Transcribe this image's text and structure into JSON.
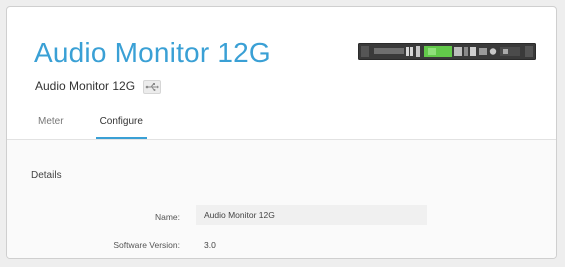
{
  "device": {
    "title": "Audio Monitor 12G",
    "subtitle": "Audio Monitor 12G",
    "connection_icon": "usb-icon"
  },
  "tabs": [
    {
      "label": "Meter",
      "active": false
    },
    {
      "label": "Configure",
      "active": true
    }
  ],
  "details": {
    "section_title": "Details",
    "name_label": "Name:",
    "name_value": "Audio Monitor 12G",
    "software_version_label": "Software Version:",
    "software_version_value": "3.0"
  },
  "colors": {
    "accent": "#3aa0d5",
    "device_led_green": "#62c94a"
  }
}
